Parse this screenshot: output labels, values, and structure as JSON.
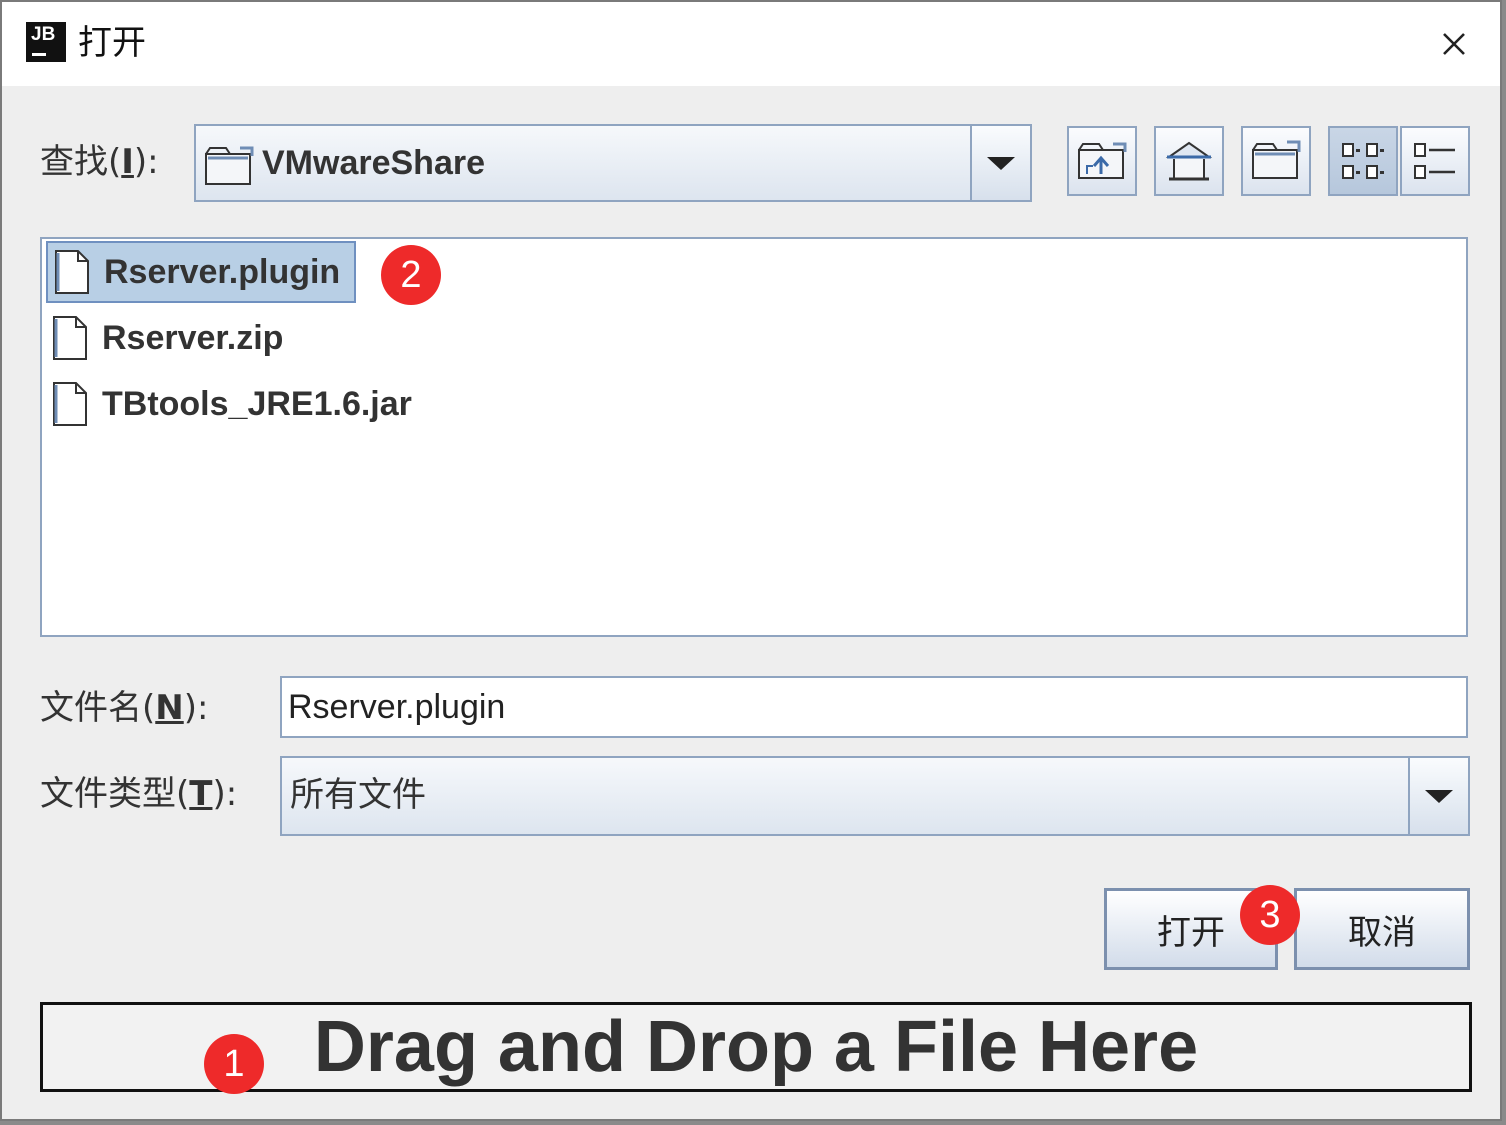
{
  "window": {
    "app_logo_text": "JB",
    "title": "打开"
  },
  "lookin": {
    "label_prefix": "查找(",
    "label_mnemonic": "I",
    "label_suffix": "):",
    "value": "VMwareShare"
  },
  "toolbar": {
    "icons": [
      "up-folder-icon",
      "home-icon",
      "new-folder-icon",
      "list-view-icon",
      "details-view-icon"
    ]
  },
  "files": [
    {
      "name": "Rserver.plugin",
      "selected": true
    },
    {
      "name": "Rserver.zip",
      "selected": false
    },
    {
      "name": "TBtools_JRE1.6.jar",
      "selected": false
    }
  ],
  "filename": {
    "label_prefix": "文件名(",
    "label_mnemonic": "N",
    "label_suffix": "):",
    "value": "Rserver.plugin"
  },
  "filetype": {
    "label_prefix": "文件类型(",
    "label_mnemonic": "T",
    "label_suffix": "):",
    "value": "所有文件"
  },
  "buttons": {
    "open": "打开",
    "cancel": "取消"
  },
  "dropzone": {
    "text": "Drag and Drop a File Here"
  },
  "annotations": [
    {
      "label": "1"
    },
    {
      "label": "2"
    },
    {
      "label": "3"
    }
  ],
  "colors": {
    "marker": "#ee2a2a",
    "selection": "#b8cfe5",
    "border": "#8fa4c0"
  }
}
